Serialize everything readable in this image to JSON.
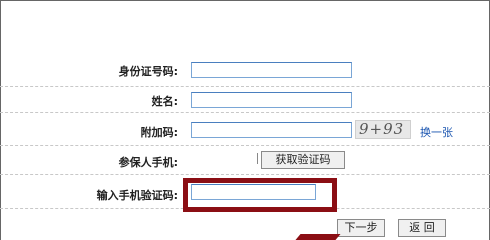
{
  "form": {
    "id_label": "身份证号码:",
    "id_value": "",
    "name_label": "姓名:",
    "name_value": "",
    "extra_code_label": "附加码:",
    "extra_code_value": "",
    "phone_label": "参保人手机:",
    "phone_value": "",
    "get_code_button": "获取验证码",
    "verify_label": "输入手机验证码:",
    "verify_value": ""
  },
  "captcha": {
    "text": "9+93",
    "refresh_label": "换一张"
  },
  "actions": {
    "next_label": "下一步",
    "back_label": "返 回"
  },
  "colors": {
    "highlight": "#8b0e14",
    "input_border": "#7aa6d6",
    "link": "#1a55b0"
  }
}
